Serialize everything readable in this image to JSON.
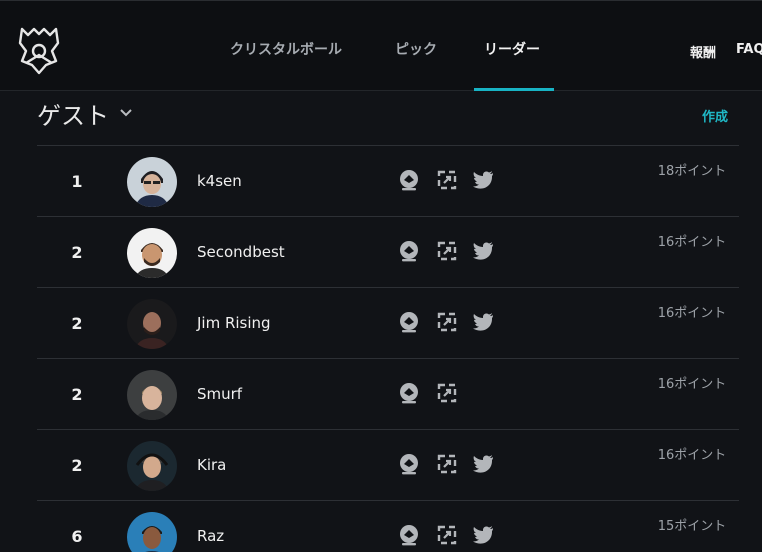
{
  "nav": {
    "items": [
      {
        "label": "クリスタルボール"
      },
      {
        "label": "ピック"
      },
      {
        "label": "リーダー"
      }
    ],
    "active_index": 2,
    "right_links": [
      "報酬",
      "FAQ"
    ]
  },
  "section": {
    "title": "ゲスト",
    "create_label": "作成"
  },
  "leaderboard": [
    {
      "rank": "1",
      "name": "k4sen",
      "points": "18ポイント",
      "has_twitter": true
    },
    {
      "rank": "2",
      "name": "Secondbest",
      "points": "16ポイント",
      "has_twitter": true
    },
    {
      "rank": "2",
      "name": "Jim Rising",
      "points": "16ポイント",
      "has_twitter": true
    },
    {
      "rank": "2",
      "name": "Smurf",
      "points": "16ポイント",
      "has_twitter": false
    },
    {
      "rank": "2",
      "name": "Kira",
      "points": "16ポイント",
      "has_twitter": true
    },
    {
      "rank": "6",
      "name": "Raz",
      "points": "15ポイント",
      "has_twitter": true
    }
  ],
  "colors": {
    "accent": "#18b3c4",
    "background": "#111317",
    "header_background": "#0d0f12"
  }
}
